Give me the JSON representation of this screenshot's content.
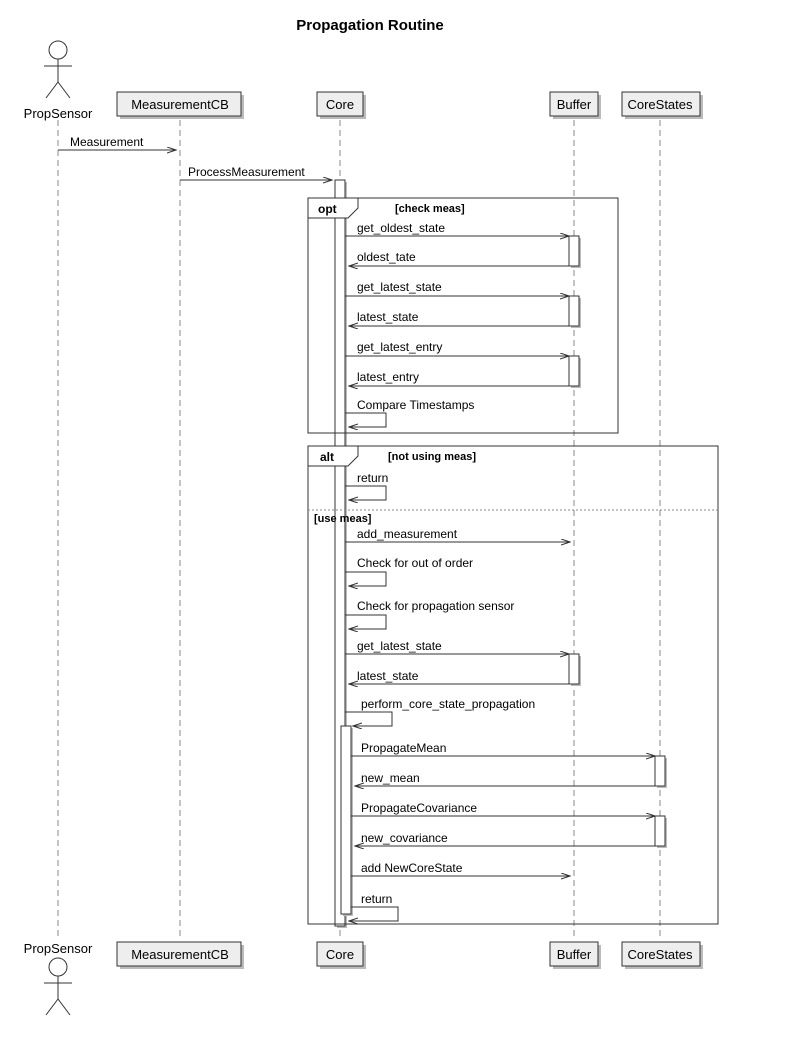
{
  "title": "Propagation Routine",
  "participants": {
    "propsensor": "PropSensor",
    "measurementcb": "MeasurementCB",
    "core": "Core",
    "buffer": "Buffer",
    "corestates": "CoreStates"
  },
  "fragments": {
    "opt_label": "opt",
    "opt_guard": "[check meas]",
    "alt_label": "alt",
    "alt_guard1": "[not using meas]",
    "alt_guard2": "[use meas]"
  },
  "messages": {
    "m1": "Measurement",
    "m2": "ProcessMeasurement",
    "m3": "get_oldest_state",
    "m4": "oldest_tate",
    "m5": "get_latest_state",
    "m6": "latest_state",
    "m7": "get_latest_entry",
    "m8": "latest_entry",
    "m9": "Compare Timestamps",
    "m10": "return",
    "m11": "add_measurement",
    "m12": "Check for out of order",
    "m13": "Check for propagation sensor",
    "m14": "get_latest_state",
    "m15": "latest_state",
    "m16": "perform_core_state_propagation",
    "m17": "PropagateMean",
    "m18": "new_mean",
    "m19": "PropagateCovariance",
    "m20": "new_covariance",
    "m21": "add NewCoreState",
    "m22": "return"
  },
  "chart_data": {
    "type": "table",
    "description": "UML sequence diagram: Propagation Routine",
    "participants": [
      "PropSensor",
      "MeasurementCB",
      "Core",
      "Buffer",
      "CoreStates"
    ],
    "interactions": [
      {
        "from": "PropSensor",
        "to": "MeasurementCB",
        "label": "Measurement",
        "kind": "async"
      },
      {
        "from": "MeasurementCB",
        "to": "Core",
        "label": "ProcessMeasurement",
        "kind": "async"
      },
      {
        "fragment": "opt",
        "guard": "[check meas]",
        "body": [
          {
            "from": "Core",
            "to": "Buffer",
            "label": "get_oldest_state",
            "kind": "async"
          },
          {
            "from": "Buffer",
            "to": "Core",
            "label": "oldest_tate",
            "kind": "return"
          },
          {
            "from": "Core",
            "to": "Buffer",
            "label": "get_latest_state",
            "kind": "async"
          },
          {
            "from": "Buffer",
            "to": "Core",
            "label": "latest_state",
            "kind": "return"
          },
          {
            "from": "Core",
            "to": "Buffer",
            "label": "get_latest_entry",
            "kind": "async"
          },
          {
            "from": "Buffer",
            "to": "Core",
            "label": "latest_entry",
            "kind": "return"
          },
          {
            "from": "Core",
            "to": "Core",
            "label": "Compare Timestamps",
            "kind": "self"
          }
        ]
      },
      {
        "fragment": "alt",
        "branches": [
          {
            "guard": "[not using meas]",
            "body": [
              {
                "from": "Core",
                "to": "Core",
                "label": "return",
                "kind": "self"
              }
            ]
          },
          {
            "guard": "[use meas]",
            "body": [
              {
                "from": "Core",
                "to": "Buffer",
                "label": "add_measurement",
                "kind": "async"
              },
              {
                "from": "Core",
                "to": "Core",
                "label": "Check for out of order",
                "kind": "self"
              },
              {
                "from": "Core",
                "to": "Core",
                "label": "Check for propagation sensor",
                "kind": "self"
              },
              {
                "from": "Core",
                "to": "Buffer",
                "label": "get_latest_state",
                "kind": "async"
              },
              {
                "from": "Buffer",
                "to": "Core",
                "label": "latest_state",
                "kind": "return"
              },
              {
                "from": "Core",
                "to": "Core",
                "label": "perform_core_state_propagation",
                "kind": "self"
              },
              {
                "from": "Core",
                "to": "CoreStates",
                "label": "PropagateMean",
                "kind": "async"
              },
              {
                "from": "CoreStates",
                "to": "Core",
                "label": "new_mean",
                "kind": "return"
              },
              {
                "from": "Core",
                "to": "CoreStates",
                "label": "PropagateCovariance",
                "kind": "async"
              },
              {
                "from": "CoreStates",
                "to": "Core",
                "label": "new_covariance",
                "kind": "return"
              },
              {
                "from": "Core",
                "to": "Buffer",
                "label": "add NewCoreState",
                "kind": "async"
              },
              {
                "from": "Core",
                "to": "Core",
                "label": "return",
                "kind": "self"
              }
            ]
          }
        ]
      }
    ]
  }
}
